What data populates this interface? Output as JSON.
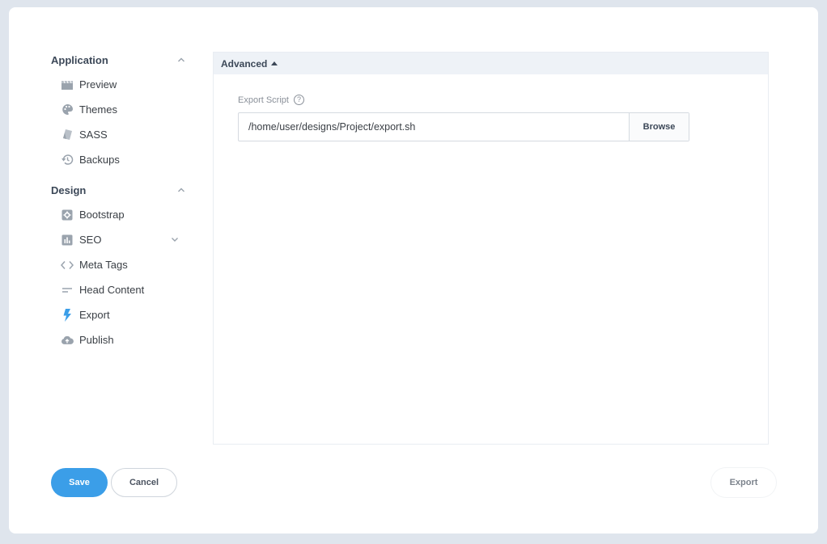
{
  "sidebar": {
    "application": {
      "title": "Application",
      "items": [
        {
          "label": "Preview",
          "icon": "film-icon"
        },
        {
          "label": "Themes",
          "icon": "palette-icon"
        },
        {
          "label": "SASS",
          "icon": "sass-icon"
        },
        {
          "label": "Backups",
          "icon": "history-icon"
        }
      ]
    },
    "design": {
      "title": "Design",
      "items": [
        {
          "label": "Bootstrap",
          "icon": "gear-icon"
        },
        {
          "label": "SEO",
          "icon": "chart-icon"
        },
        {
          "label": "Meta Tags",
          "icon": "code-icon"
        },
        {
          "label": "Head Content",
          "icon": "lines-icon"
        },
        {
          "label": "Export",
          "icon": "bolt-icon"
        },
        {
          "label": "Publish",
          "icon": "cloud-upload-icon"
        }
      ]
    }
  },
  "panel": {
    "header": "Advanced",
    "field_label": "Export Script",
    "help_glyph": "?",
    "input_value": "/home/user/designs/Project/export.sh",
    "browse_label": "Browse"
  },
  "footer": {
    "save_label": "Save",
    "cancel_label": "Cancel",
    "export_label": "Export"
  },
  "colors": {
    "accent": "#3b9ee8",
    "icon_gray": "#9aa3ad",
    "export_icon": "#3b9ee8",
    "backdrop": "#dfe5ed"
  }
}
